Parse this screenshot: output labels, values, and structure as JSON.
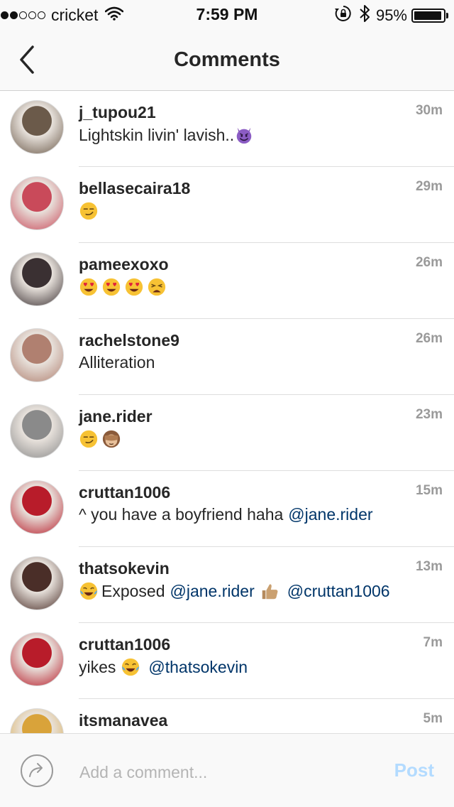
{
  "status_bar": {
    "carrier": "cricket",
    "signal_bars": 2,
    "signal_total": 5,
    "time": "7:59 PM",
    "battery": "95%",
    "battery_level": 0.95
  },
  "nav": {
    "title": "Comments",
    "back_icon": "chevron-left-icon"
  },
  "comments": [
    {
      "username": "j_tupou21",
      "time": "30m",
      "text": "Lightskin livin' lavish..",
      "emoji": [
        "smiling-imp"
      ],
      "avatar_color": "#6b5a4a"
    },
    {
      "username": "bellasecaira18",
      "time": "29m",
      "emoji": [
        "smirk"
      ],
      "avatar_color": "#c94a5a"
    },
    {
      "username": "pameexoxo",
      "time": "26m",
      "emoji": [
        "heart-eyes",
        "heart-eyes",
        "heart-eyes",
        "weary"
      ],
      "avatar_color": "#3a3032"
    },
    {
      "username": "rachelstone9",
      "time": "26m",
      "text": "Alliteration",
      "avatar_color": "#b08070"
    },
    {
      "username": "jane.rider",
      "time": "23m",
      "emoji": [
        "smirk",
        "see-no-evil"
      ],
      "avatar_color": "#8a8a8a"
    },
    {
      "username": "cruttan1006",
      "time": "15m",
      "text": "^ you have a boyfriend haha",
      "mention": "@jane.rider",
      "avatar_color": "#b81c2a"
    },
    {
      "username": "thatsokevin",
      "time": "13m",
      "text": "Exposed",
      "mention": "@jane.rider",
      "mention2": "@cruttan1006",
      "emoji": [
        "joy",
        "thumbs-up"
      ],
      "avatar_color": "#4a2e28"
    },
    {
      "username": "cruttan1006",
      "time": "7m",
      "text": "yikes",
      "mention": "@thatsokevin",
      "emoji": [
        "joy"
      ],
      "avatar_color": "#b81c2a"
    },
    {
      "username": "itsmanavea",
      "time": "5m",
      "avatar_color": "#d9a33a"
    }
  ],
  "comment_bar": {
    "placeholder": "Add a comment...",
    "post_label": "Post",
    "share_icon": "share-arrow-icon"
  },
  "colors": {
    "mention": "#003569",
    "timestamp": "#9a9a9a",
    "post_disabled": "#b3dbff"
  }
}
